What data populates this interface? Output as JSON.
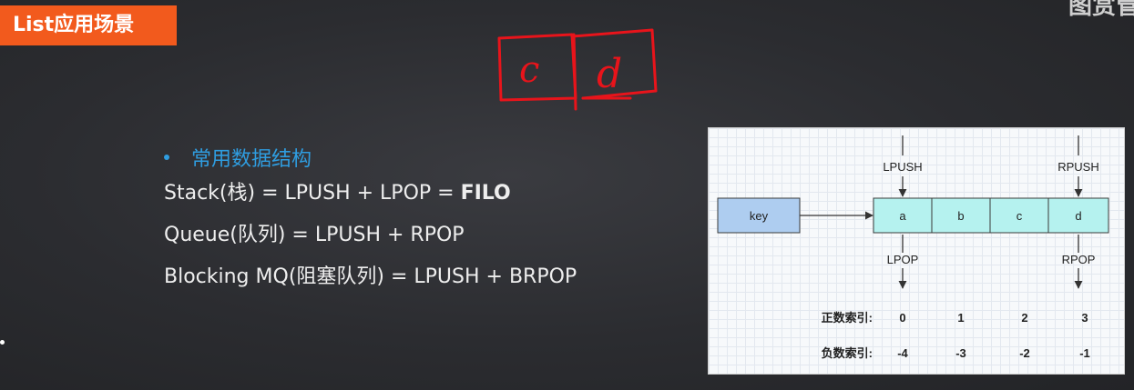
{
  "header": {
    "title": "List应用场景",
    "corner_text": "图赏管"
  },
  "content": {
    "heading": "常用数据结构",
    "lines": [
      {
        "prefix": "Stack(栈) = LPUSH + LPOP = ",
        "bold": "FILO"
      },
      {
        "prefix": "Queue(队列)  = LPUSH + RPOP",
        "bold": ""
      },
      {
        "prefix": "Blocking MQ(阻塞队列)  = LPUSH + BRPOP",
        "bold": ""
      }
    ]
  },
  "handwriting": {
    "letters": [
      "c",
      "d"
    ],
    "color": "#e8141b"
  },
  "diagram": {
    "key_label": "key",
    "cells": [
      "a",
      "b",
      "c",
      "d"
    ],
    "lpush": "LPUSH",
    "rpush": "RPUSH",
    "lpop": "LPOP",
    "rpop": "RPOP",
    "pos_label": "正数索引:",
    "neg_label": "负数索引:",
    "pos_index": [
      "0",
      "1",
      "2",
      "3"
    ],
    "neg_index": [
      "-4",
      "-3",
      "-2",
      "-1"
    ],
    "colors": {
      "key_fill": "#aecdf0",
      "cell_fill": "#b5f2ef",
      "stroke": "#3a3a3a"
    }
  }
}
